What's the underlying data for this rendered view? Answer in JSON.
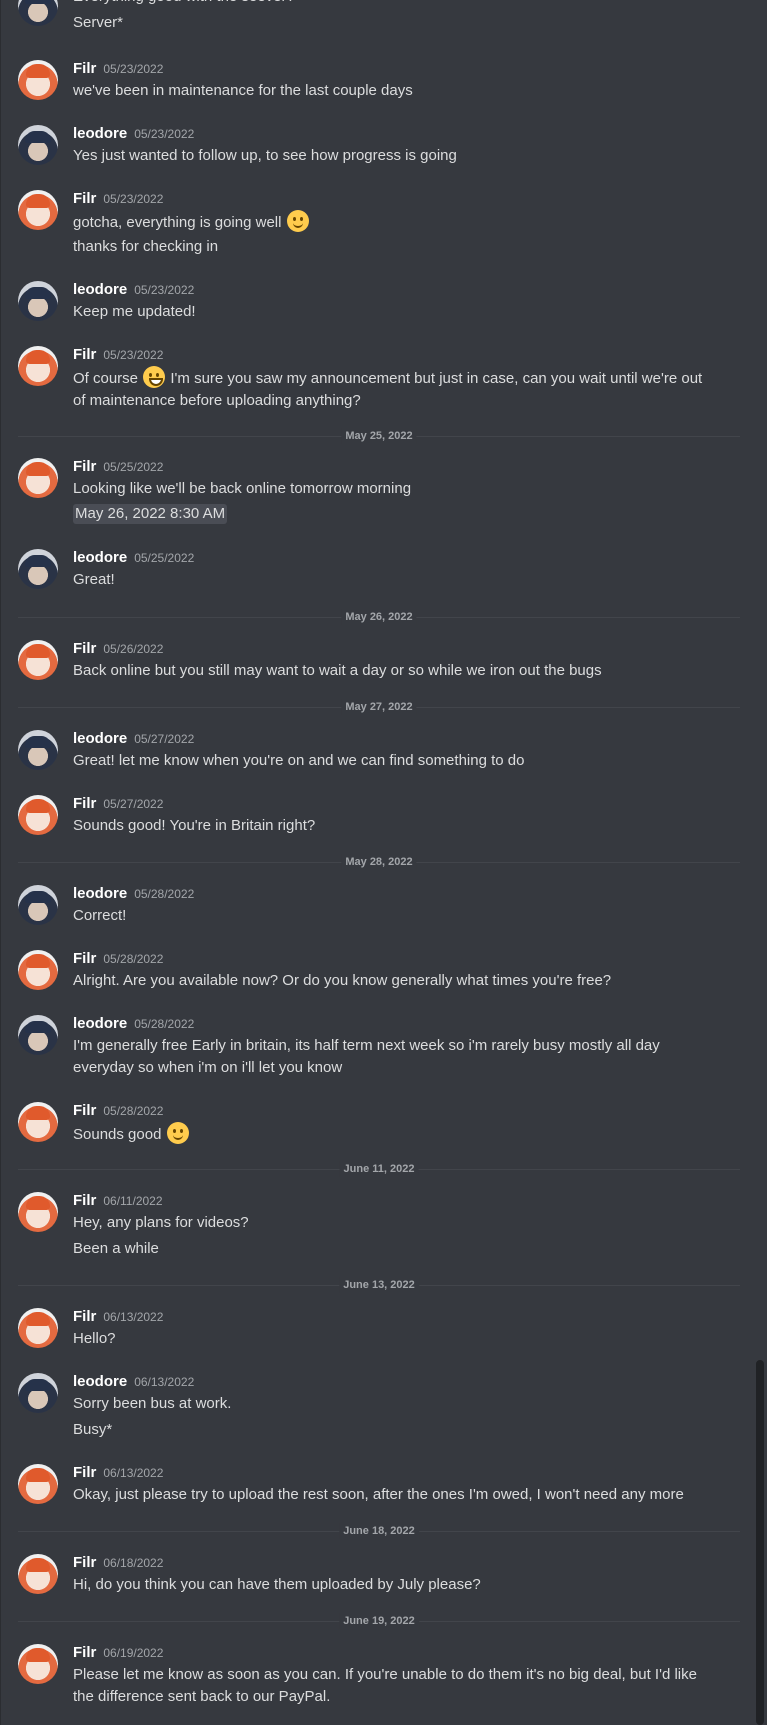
{
  "conversation": {
    "m0": {
      "lines": [
        "Everything good with the seever?",
        "Server*"
      ]
    },
    "m1": {
      "author": "Filr",
      "date": "05/23/2022",
      "lines": [
        "we've been in maintenance for the last couple days"
      ]
    },
    "m2": {
      "author": "leodore",
      "date": "05/23/2022",
      "lines": [
        "Yes just wanted to follow up, to see how progress is going"
      ]
    },
    "m3": {
      "author": "Filr",
      "date": "05/23/2022",
      "lines": [
        "gotcha, everything is going well",
        "thanks for checking in"
      ]
    },
    "m4": {
      "author": "leodore",
      "date": "05/23/2022",
      "lines": [
        "Keep me updated!"
      ]
    },
    "m5": {
      "author": "Filr",
      "date": "05/23/2022",
      "a": "Of course",
      "b": "I'm sure you saw my announcement but just in case, can you wait until we're out of maintenance before uploading anything?"
    },
    "d1": "May 25, 2022",
    "m6": {
      "author": "Filr",
      "date": "05/25/2022",
      "lines": [
        "Looking like we'll be back online tomorrow morning",
        "May 26, 2022 8:30 AM"
      ]
    },
    "m7": {
      "author": "leodore",
      "date": "05/25/2022",
      "lines": [
        "Great!"
      ]
    },
    "d2": "May 26, 2022",
    "m8": {
      "author": "Filr",
      "date": "05/26/2022",
      "lines": [
        "Back online but you still may want to wait a day or so while we iron out the bugs"
      ]
    },
    "d3": "May 27, 2022",
    "m9": {
      "author": "leodore",
      "date": "05/27/2022",
      "lines": [
        "Great! let me know when you're on and we can find something to do"
      ]
    },
    "m10": {
      "author": "Filr",
      "date": "05/27/2022",
      "lines": [
        "Sounds good! You're in Britain right?"
      ]
    },
    "d4": "May 28, 2022",
    "m11": {
      "author": "leodore",
      "date": "05/28/2022",
      "lines": [
        "Correct!"
      ]
    },
    "m12": {
      "author": "Filr",
      "date": "05/28/2022",
      "lines": [
        "Alright. Are you available now? Or do you know generally what times you're free?"
      ]
    },
    "m13": {
      "author": "leodore",
      "date": "05/28/2022",
      "text": "I'm generally free Early in britain, its half term next week so i'm rarely busy mostly all day everyday so when i'm on i'll let you know"
    },
    "m14": {
      "author": "Filr",
      "date": "05/28/2022",
      "lines": [
        "Sounds good"
      ]
    },
    "d5": "June 11, 2022",
    "m15": {
      "author": "Filr",
      "date": "06/11/2022",
      "lines": [
        "Hey, any plans for videos?",
        "Been a while"
      ]
    },
    "d6": "June 13, 2022",
    "m16": {
      "author": "Filr",
      "date": "06/13/2022",
      "lines": [
        "Hello?"
      ]
    },
    "m17": {
      "author": "leodore",
      "date": "06/13/2022",
      "lines": [
        "Sorry been bus at work.",
        "Busy*"
      ]
    },
    "m18": {
      "author": "Filr",
      "date": "06/13/2022",
      "lines": [
        "Okay, just please try to upload the rest soon, after the ones I'm owed, I won't need any more"
      ]
    },
    "d7": "June 18, 2022",
    "m19": {
      "author": "Filr",
      "date": "06/18/2022",
      "lines": [
        "Hi, do you think you can have them uploaded by July please?"
      ]
    },
    "d8": "June 19, 2022",
    "m20": {
      "author": "Filr",
      "date": "06/19/2022",
      "text": "Please let me know as soon as you can. If you're unable to do them it's no big deal, but I'd like the difference sent back to our PayPal."
    }
  },
  "icons": {
    "smile": "slightly-smiling-face-icon",
    "grin": "grinning-face-icon"
  }
}
